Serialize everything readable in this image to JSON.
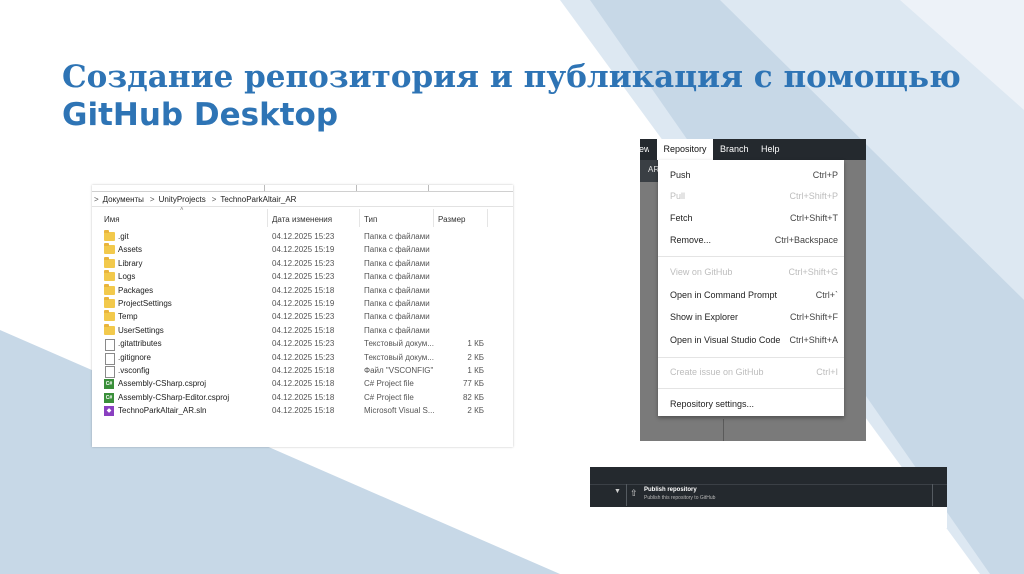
{
  "slide": {
    "title_line1": "Создание репозитория и публикация с помощью",
    "title_line2": "GitHub Desktop"
  },
  "explorer": {
    "breadcrumb": [
      "Документы",
      "UnityProjects",
      "TechnoParkAltair_AR"
    ],
    "breadcrumb_separator": ">",
    "columns": {
      "name": "Имя",
      "date": "Дата изменения",
      "type": "Тип",
      "size": "Размер"
    },
    "rows": [
      {
        "icon": "folder-icon",
        "name": ".git",
        "date": "04.12.2025 15:23",
        "type": "Папка с файлами",
        "size": ""
      },
      {
        "icon": "folder-icon",
        "name": "Assets",
        "date": "04.12.2025 15:19",
        "type": "Папка с файлами",
        "size": ""
      },
      {
        "icon": "folder-icon",
        "name": "Library",
        "date": "04.12.2025 15:23",
        "type": "Папка с файлами",
        "size": ""
      },
      {
        "icon": "folder-icon",
        "name": "Logs",
        "date": "04.12.2025 15:23",
        "type": "Папка с файлами",
        "size": ""
      },
      {
        "icon": "folder-icon",
        "name": "Packages",
        "date": "04.12.2025 15:18",
        "type": "Папка с файлами",
        "size": ""
      },
      {
        "icon": "folder-icon",
        "name": "ProjectSettings",
        "date": "04.12.2025 15:19",
        "type": "Папка с файлами",
        "size": ""
      },
      {
        "icon": "folder-icon",
        "name": "Temp",
        "date": "04.12.2025 15:23",
        "type": "Папка с файлами",
        "size": ""
      },
      {
        "icon": "folder-icon",
        "name": "UserSettings",
        "date": "04.12.2025 15:18",
        "type": "Папка с файлами",
        "size": ""
      },
      {
        "icon": "file-icon",
        "name": ".gitattributes",
        "date": "04.12.2025 15:23",
        "type": "Текстовый докум...",
        "size": "1 КБ"
      },
      {
        "icon": "file-icon",
        "name": ".gitignore",
        "date": "04.12.2025 15:23",
        "type": "Текстовый докум...",
        "size": "2 КБ"
      },
      {
        "icon": "file-icon",
        "name": ".vsconfig",
        "date": "04.12.2025 15:18",
        "type": "Файл \"VSCONFIG\"",
        "size": "1 КБ"
      },
      {
        "icon": "csproj-icon",
        "name": "Assembly-CSharp.csproj",
        "date": "04.12.2025 15:18",
        "type": "C# Project file",
        "size": "77 КБ"
      },
      {
        "icon": "csproj-icon",
        "name": "Assembly-CSharp-Editor.csproj",
        "date": "04.12.2025 15:18",
        "type": "C# Project file",
        "size": "82 КБ"
      },
      {
        "icon": "sln-icon",
        "name": "TechnoParkAltair_AR.sln",
        "date": "04.12.2025 15:18",
        "type": "Microsoft Visual S...",
        "size": "2 КБ"
      }
    ]
  },
  "github_menu": {
    "menubar": {
      "cut_item": "ew",
      "repository": "Repository",
      "branch": "Branch",
      "help": "Help"
    },
    "side_cut_text": "AR",
    "items": [
      {
        "label": "Push",
        "shortcut": "Ctrl+P",
        "disabled": false
      },
      {
        "label": "Pull",
        "shortcut": "Ctrl+Shift+P",
        "disabled": true
      },
      {
        "label": "Fetch",
        "shortcut": "Ctrl+Shift+T",
        "disabled": false
      },
      {
        "label": "Remove...",
        "shortcut": "Ctrl+Backspace",
        "disabled": false
      },
      {
        "label": "View on GitHub",
        "shortcut": "Ctrl+Shift+G",
        "disabled": true
      },
      {
        "label": "Open in Command Prompt",
        "shortcut": "Ctrl+`",
        "disabled": false
      },
      {
        "label": "Show in Explorer",
        "shortcut": "Ctrl+Shift+F",
        "disabled": false
      },
      {
        "label": "Open in Visual Studio Code",
        "shortcut": "Ctrl+Shift+A",
        "disabled": false
      },
      {
        "label": "Create issue on GitHub",
        "shortcut": "Ctrl+I",
        "disabled": true
      },
      {
        "label": "Repository settings...",
        "shortcut": "",
        "disabled": false
      }
    ]
  },
  "publish_bar": {
    "chevron_icon": "chevron-down-icon",
    "upload_icon": "upload-icon",
    "title": "Publish repository",
    "subtitle": "Publish this repository to GitHub"
  },
  "colors": {
    "title": "#2e74b5",
    "shape_blue": "#c7d8e7",
    "shape_blue_light": "#dde8f2",
    "github_dark": "#24292e",
    "folder": "#f2c94c"
  }
}
